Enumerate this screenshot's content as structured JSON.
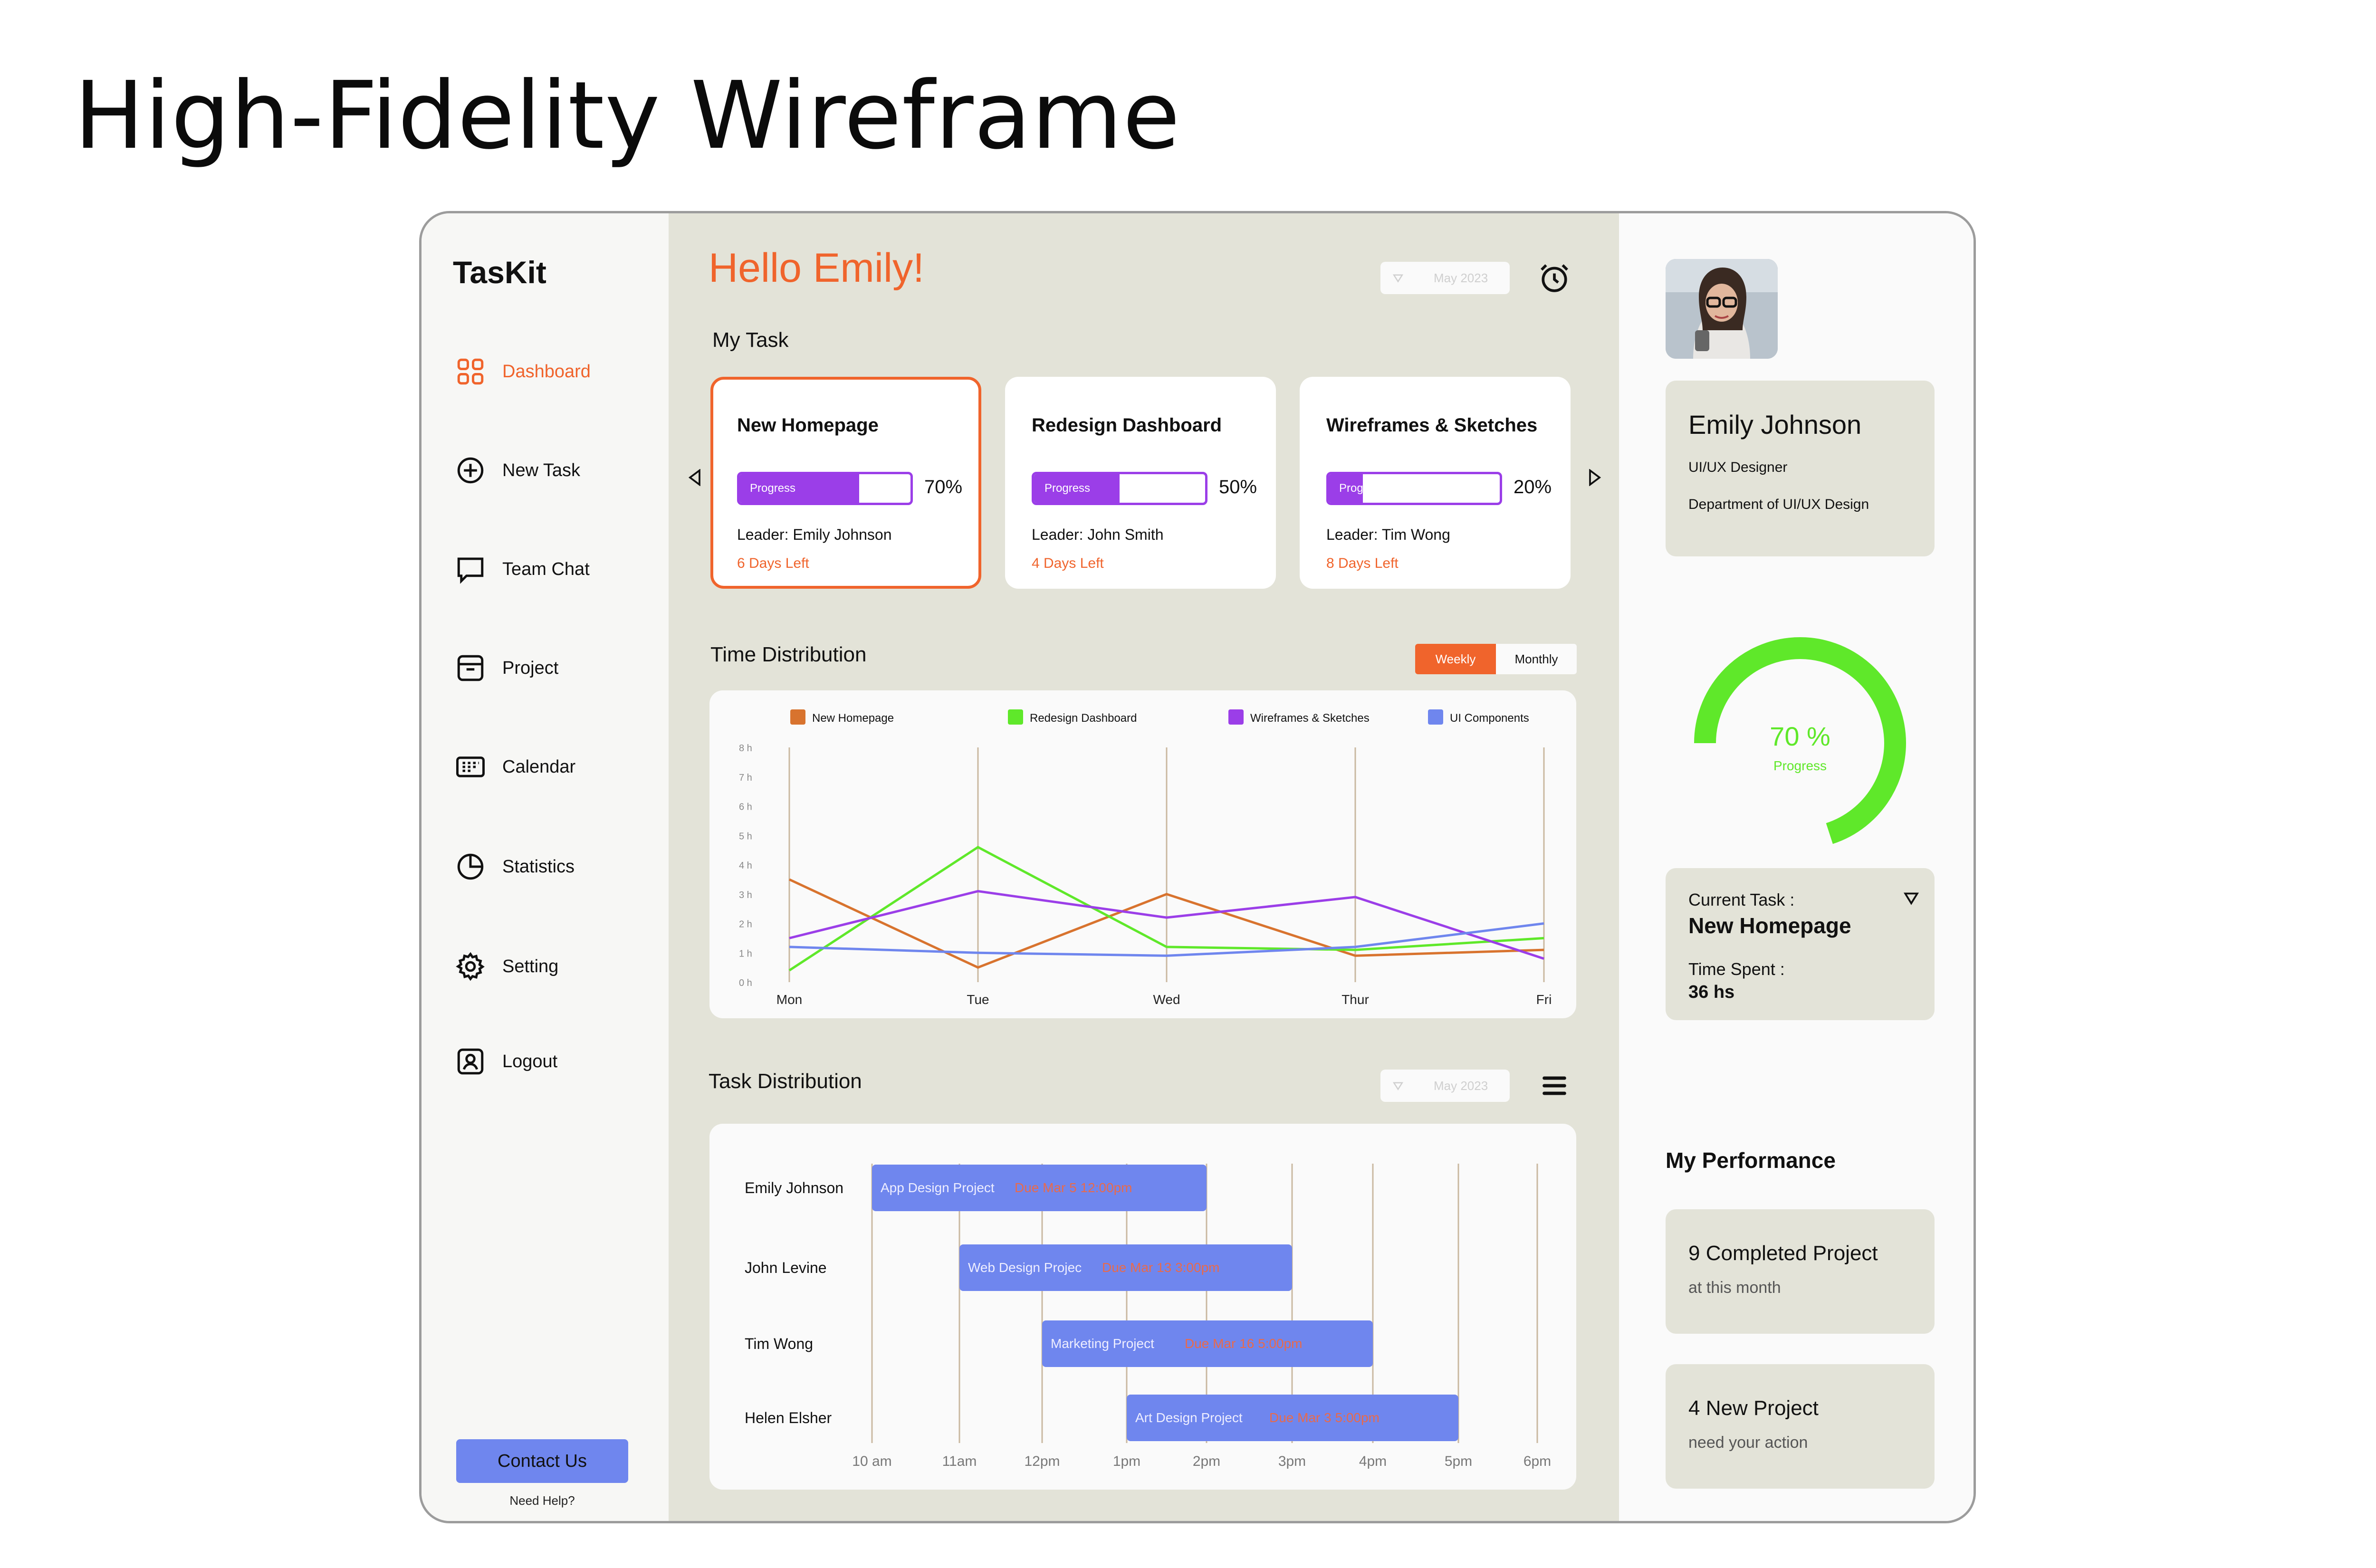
{
  "page_title": "High-Fidelity Wireframe",
  "brand": "TasKit",
  "nav": [
    {
      "label": "Dashboard",
      "icon": "grid-icon",
      "active": true
    },
    {
      "label": "New Task",
      "icon": "plus-circle-icon"
    },
    {
      "label": "Team Chat",
      "icon": "chat-icon"
    },
    {
      "label": "Project",
      "icon": "archive-icon"
    },
    {
      "label": "Calendar",
      "icon": "calendar-icon"
    },
    {
      "label": "Statistics",
      "icon": "pie-chart-icon"
    },
    {
      "label": "Setting",
      "icon": "gear-icon"
    },
    {
      "label": "Logout",
      "icon": "user-square-icon"
    }
  ],
  "contact": {
    "button": "Contact Us",
    "help": "Need Help?"
  },
  "header": {
    "greeting": "Hello Emily!",
    "date": "May 2023"
  },
  "my_task": {
    "label": "My Task",
    "cards": [
      {
        "title": "New Homepage",
        "progress_label": "Progress",
        "progress": 70,
        "progress_text": "70%",
        "leader": "Leader: Emily Johnson",
        "days": "6 Days Left"
      },
      {
        "title": "Redesign Dashboard",
        "progress_label": "Progress",
        "progress": 50,
        "progress_text": "50%",
        "leader": "Leader: John Smith",
        "days": "4 Days Left"
      },
      {
        "title": "Wireframes & Sketches",
        "progress_label": "Progress",
        "progress": 20,
        "progress_text": "20%",
        "leader": "Leader: Tim Wong",
        "days": "8 Days Left"
      }
    ]
  },
  "time_distribution": {
    "label": "Time Distribution",
    "toggle": [
      "Weekly",
      "Monthly"
    ],
    "active_toggle": "Weekly"
  },
  "task_distribution": {
    "label": "Task Distribution",
    "date": "May 2023",
    "rows": [
      {
        "name": "Emily Johnson",
        "project": "App Design Project",
        "due": "Due Mar 5 12:00pm",
        "start": 0,
        "end": 4
      },
      {
        "name": "John Levine",
        "project": "Web Design Projec",
        "due": "Due Mar 13 3:00pm",
        "start": 1,
        "end": 5
      },
      {
        "name": "Tim Wong",
        "project": "Marketing Project",
        "due": "Due Mar 16 5:00pm",
        "start": 2,
        "end": 6
      },
      {
        "name": "Helen Elsher",
        "project": "Art Design Project",
        "due": "Due Mar 3 5:00pm",
        "start": 3,
        "end": 7
      }
    ],
    "times": [
      "10 am",
      "11am",
      "12pm",
      "1pm",
      "2pm",
      "3pm",
      "4pm",
      "5pm",
      "6pm"
    ]
  },
  "chart_data": {
    "type": "line",
    "categories": [
      "Mon",
      "Tue",
      "Wed",
      "Thur",
      "Fri"
    ],
    "y_ticks": [
      "0 h",
      "1 h",
      "2 h",
      "3 h",
      "4 h",
      "5 h",
      "6 h",
      "7 h",
      "8 h"
    ],
    "ylim": [
      0,
      8
    ],
    "legend_position": "top",
    "grid": "vertical",
    "series": [
      {
        "name": "New Homepage",
        "color": "#d8732e",
        "values": [
          3.5,
          0.5,
          3.0,
          0.9,
          1.1
        ]
      },
      {
        "name": "Redesign Dashboard",
        "color": "#5fe82a",
        "values": [
          0.4,
          4.6,
          1.2,
          1.1,
          1.5
        ]
      },
      {
        "name": "Wireframes & Sketches",
        "color": "#9b3ee8",
        "values": [
          1.5,
          3.1,
          2.2,
          2.9,
          0.8
        ]
      },
      {
        "name": "UI Components",
        "color": "#6f86ee",
        "values": [
          1.2,
          1.0,
          0.9,
          1.2,
          2.0
        ]
      }
    ]
  },
  "profile": {
    "name": "Emily Johnson",
    "role": "UI/UX Designer",
    "department": "Department of UI/UX Design",
    "progress": 70,
    "progress_text": "70 %",
    "progress_label": "Progress"
  },
  "current_task": {
    "label": "Current Task :",
    "name": "New Homepage",
    "time_label": "Time Spent :",
    "time": "36 hs"
  },
  "performance": {
    "title": "My Performance",
    "items": [
      {
        "main": "9 Completed Project",
        "sub": "at this month"
      },
      {
        "main": "4 New Project",
        "sub": "need your action"
      }
    ]
  },
  "colors": {
    "accent": "#f0642c",
    "purple": "#9b3ee8",
    "blue": "#6f86ee",
    "green": "#5fe82a"
  }
}
